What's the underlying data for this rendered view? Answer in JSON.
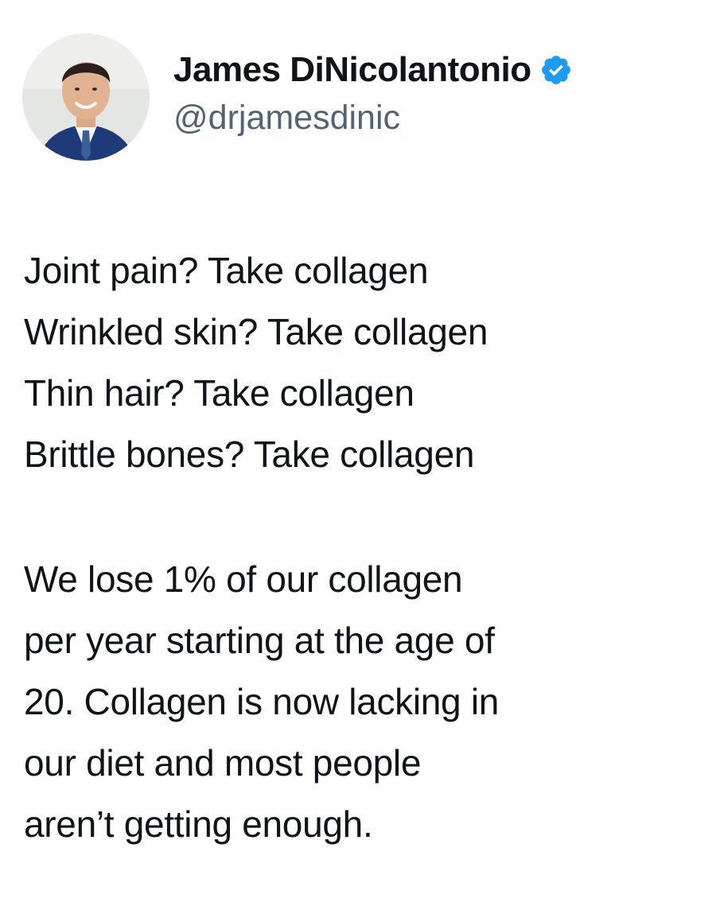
{
  "author": {
    "display_name": "James DiNicolantonio",
    "handle": "@drjamesdinic",
    "verified": true,
    "verified_badge_icon": "verified-badge-icon",
    "verified_color": "#1d9bf0"
  },
  "tweet": {
    "paragraph1": [
      "Joint pain? Take collagen",
      "Wrinkled skin? Take collagen",
      "Thin hair? Take collagen",
      "Brittle bones? Take collagen"
    ],
    "paragraph2": [
      "We lose 1% of our collagen",
      "per year starting at the age of",
      "20. Collagen is now lacking in",
      "our diet and most people",
      "aren’t getting enough."
    ]
  },
  "colors": {
    "text": "#0f1419",
    "secondary_text": "#536471",
    "background": "#ffffff"
  }
}
